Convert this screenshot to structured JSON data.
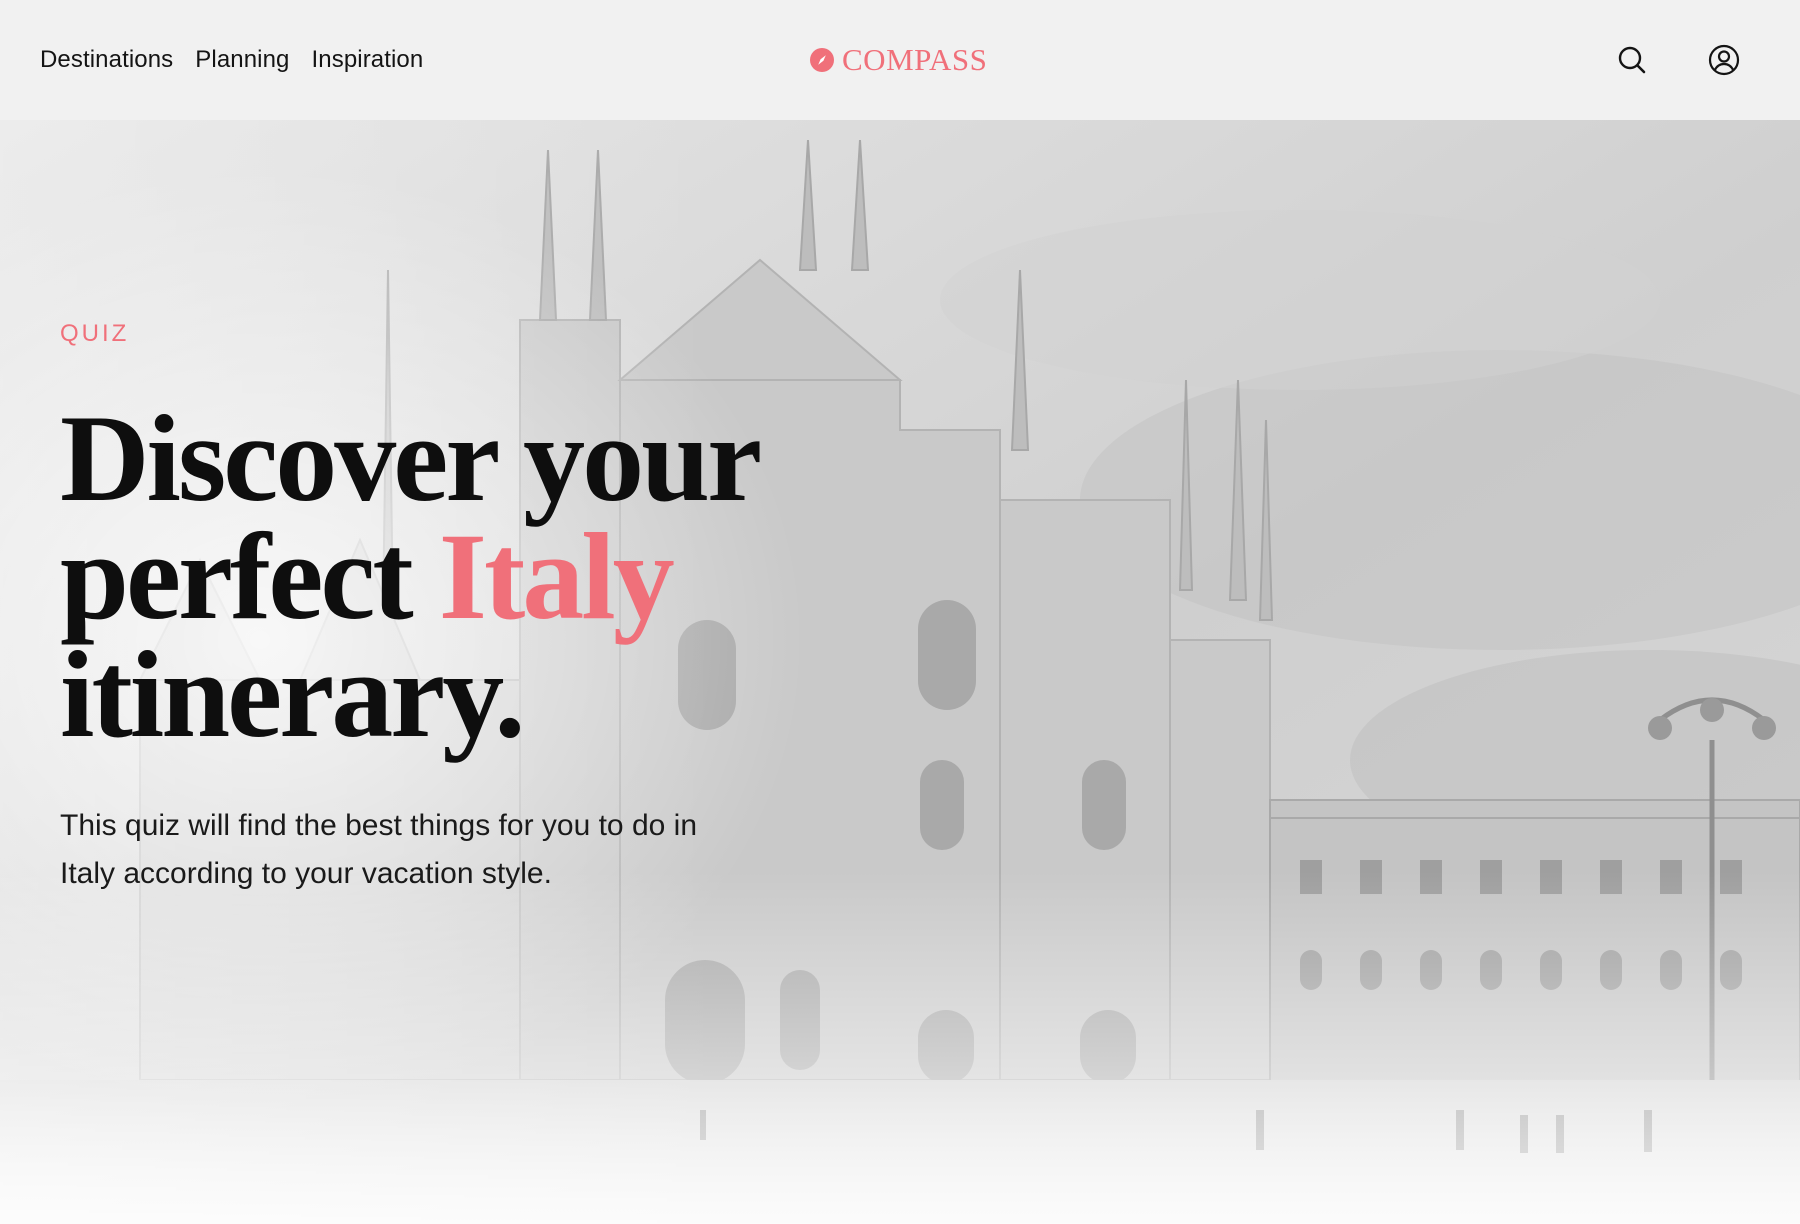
{
  "nav": {
    "items": [
      {
        "label": "Destinations"
      },
      {
        "label": "Planning"
      },
      {
        "label": "Inspiration"
      }
    ]
  },
  "logo": {
    "text": "COMPASS",
    "icon": "compass-icon"
  },
  "header_icons": {
    "search": "search-icon",
    "account": "user-circle-icon"
  },
  "hero": {
    "eyebrow": "QUIZ",
    "headline": {
      "line1": "Discover your",
      "line2_before": "perfect ",
      "line2_accent": "Italy",
      "line3": "itinerary."
    },
    "description": "This quiz will find the best things for you to do in Italy according to your vacation style."
  },
  "colors": {
    "accent": "#f0707a",
    "text_dark": "#0e0e0e",
    "header_bg": "#f1f1f1"
  }
}
